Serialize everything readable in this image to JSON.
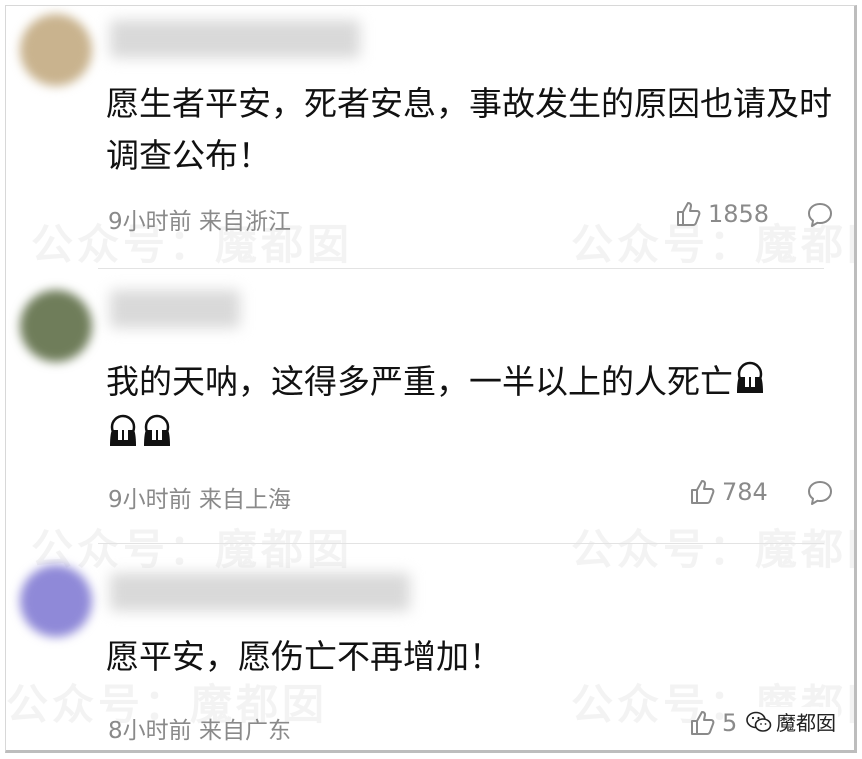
{
  "watermark_text": "公众号：魔都囡",
  "badge": {
    "label": "魔都囡",
    "icon": "wechat-icon"
  },
  "comments": [
    {
      "text": "愿生者平安，死者安息，事故发生的原因也请及时调查公布！",
      "meta": "9小时前 来自浙江",
      "likes": "1858",
      "avatar_color": "#c9b38e"
    },
    {
      "text": "我的天呐，这得多严重，一半以上的人死亡",
      "emoji": "crying-face-emoji",
      "meta": "9小时前 来自上海",
      "likes": "784",
      "avatar_color": "#6f7d5a"
    },
    {
      "text": "愿平安，愿伤亡不再增加！",
      "meta": "8小时前 来自广东",
      "likes": "5",
      "avatar_color": "#8f89d8"
    }
  ]
}
